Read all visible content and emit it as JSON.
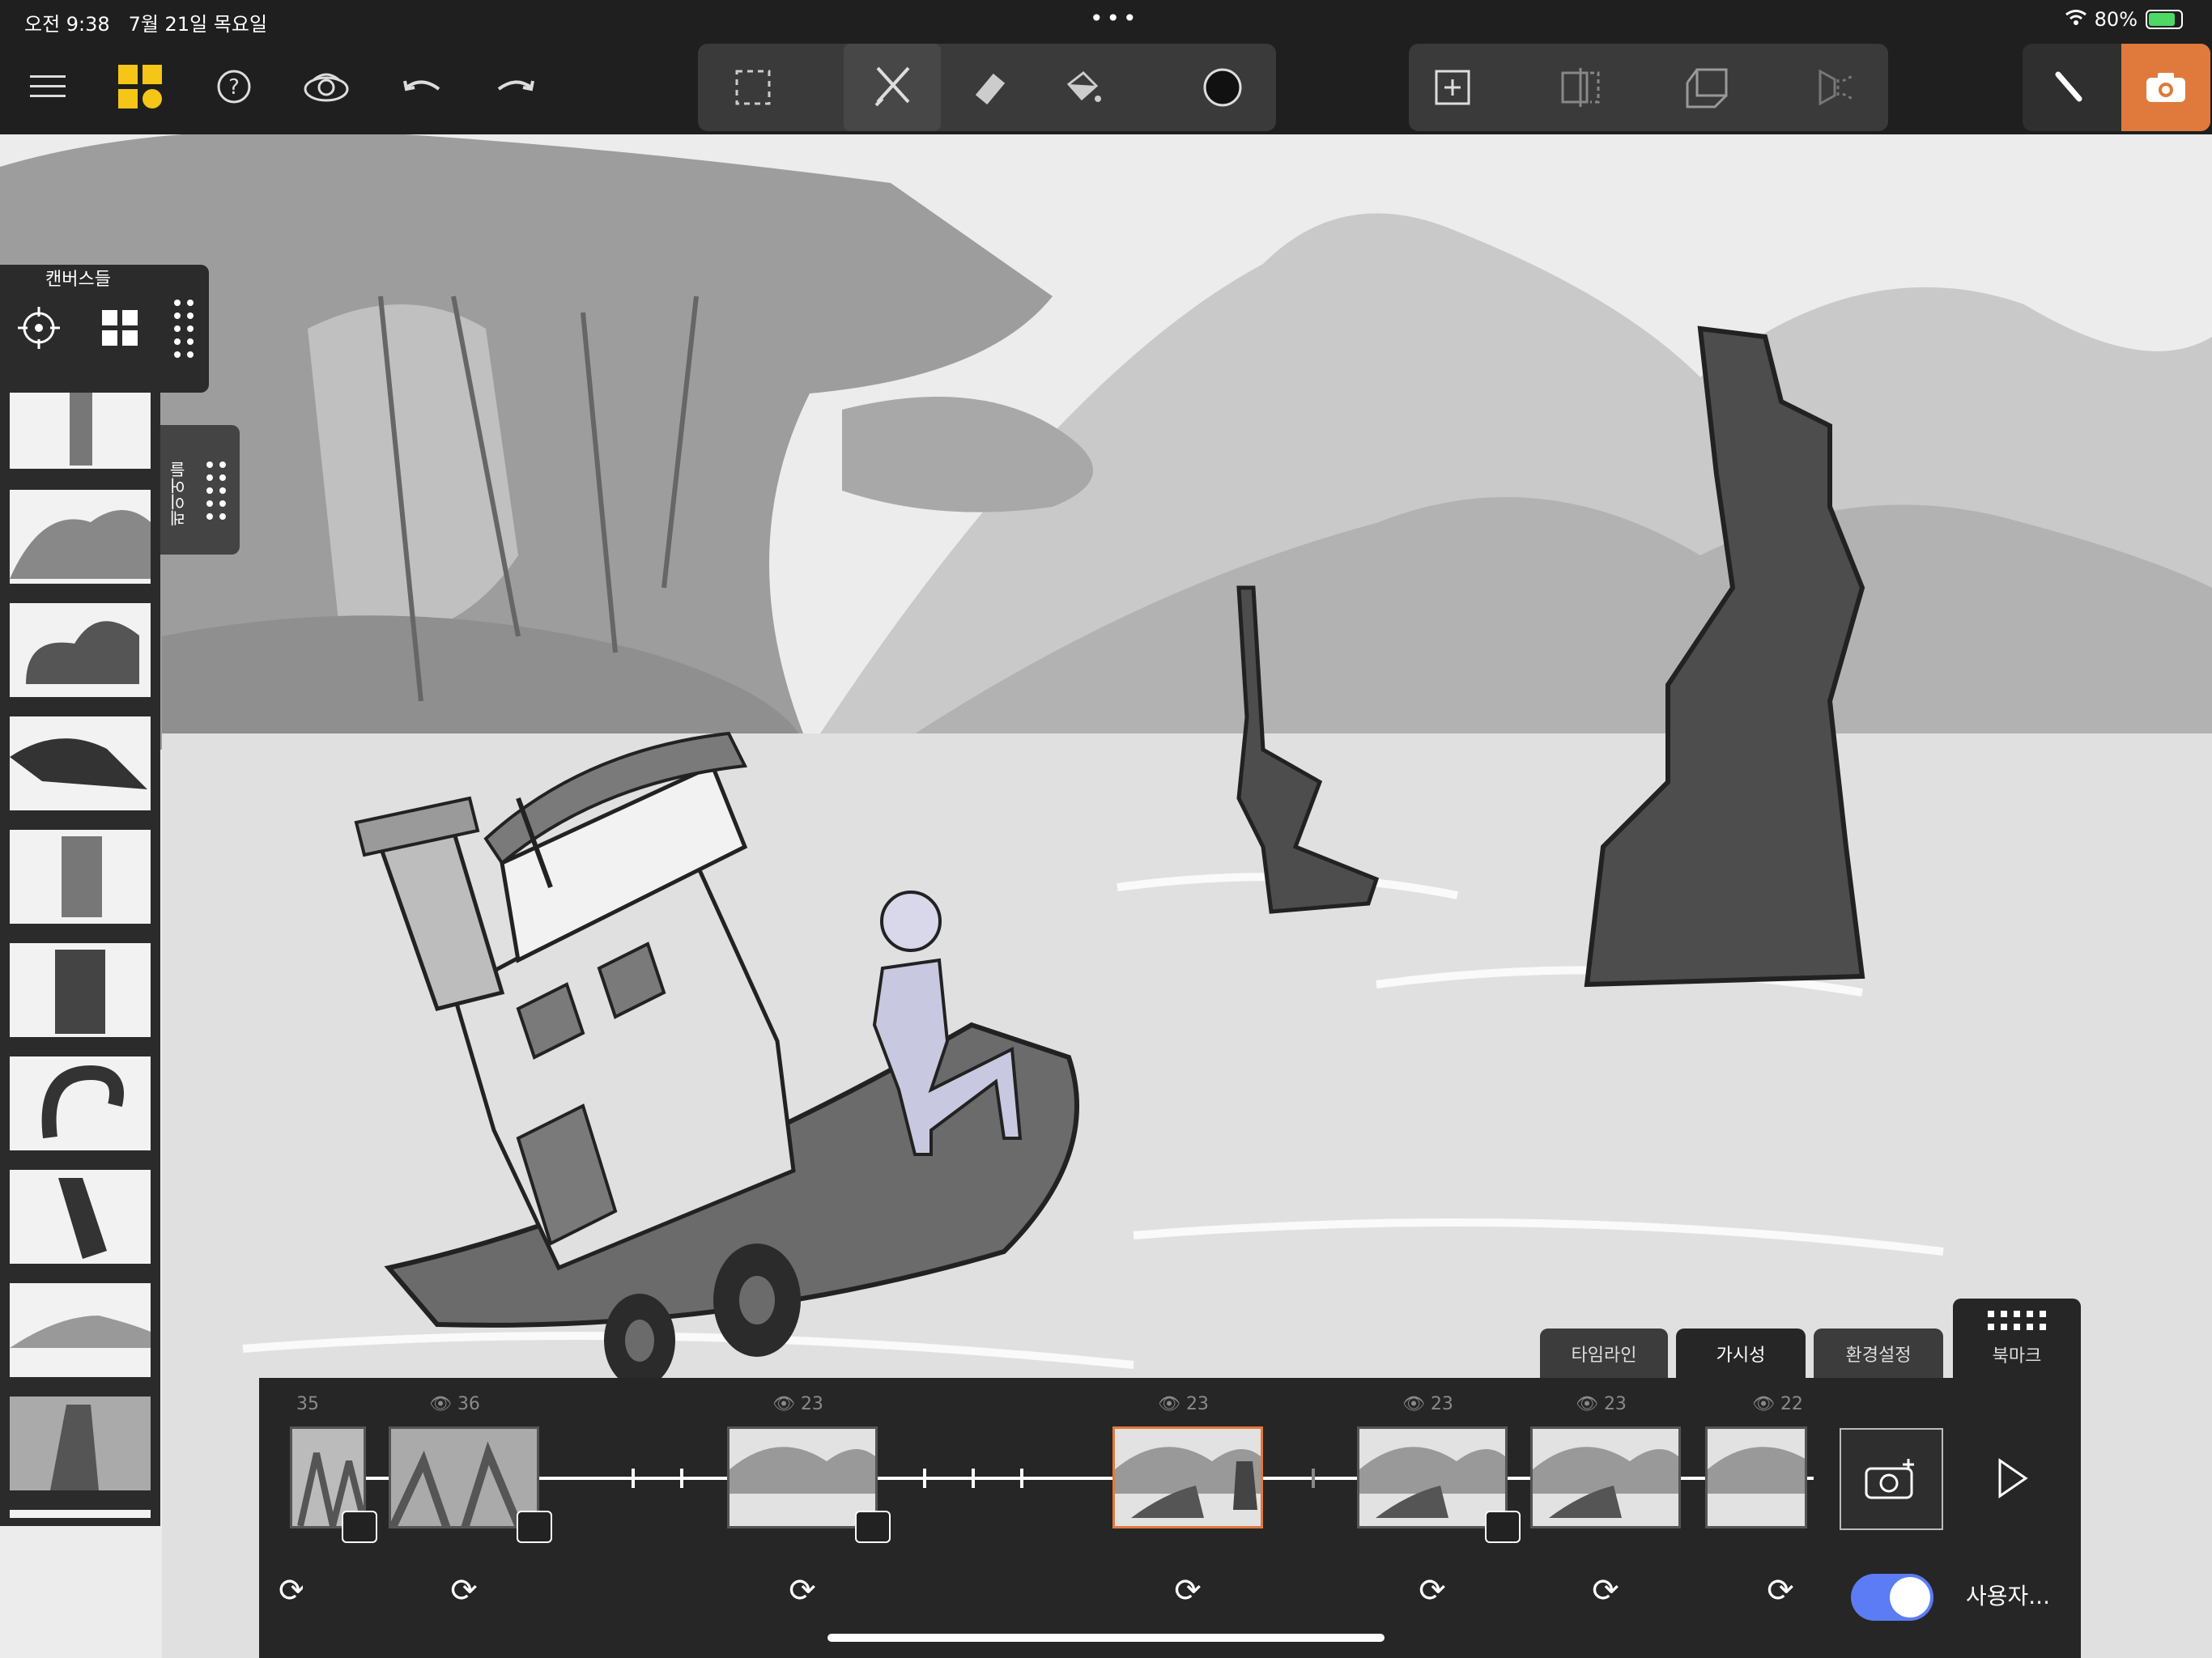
{
  "status": {
    "time": "오전 9:38",
    "date": "7월 21일 목요일",
    "dots": "•••",
    "battery": "80%"
  },
  "topbar": {
    "left_icons": [
      "menu-icon",
      "gallery-icon",
      "help-icon",
      "visibility-icon",
      "undo-icon",
      "redo-icon"
    ],
    "tools": [
      "selection-icon",
      "pencil-icon",
      "eraser-icon",
      "fill-icon",
      "color-swatch-icon"
    ],
    "canvas_tools": [
      "add-canvas-icon",
      "split-canvas-icon",
      "transform-icon",
      "flip-icon"
    ],
    "mode_buttons": [
      "brush-mode-icon",
      "camera-mode-icon"
    ],
    "accent": "#e07a3c"
  },
  "canvases": {
    "title": "캔버스들",
    "layers_label": "레이어들"
  },
  "timeline": {
    "tabs": [
      "타임라인",
      "가시성",
      "환경설정",
      "북마크"
    ],
    "frame_counts": [
      "35",
      "36",
      "23",
      "23",
      "23",
      "23",
      "22"
    ],
    "toggle_label": "사용자..."
  }
}
